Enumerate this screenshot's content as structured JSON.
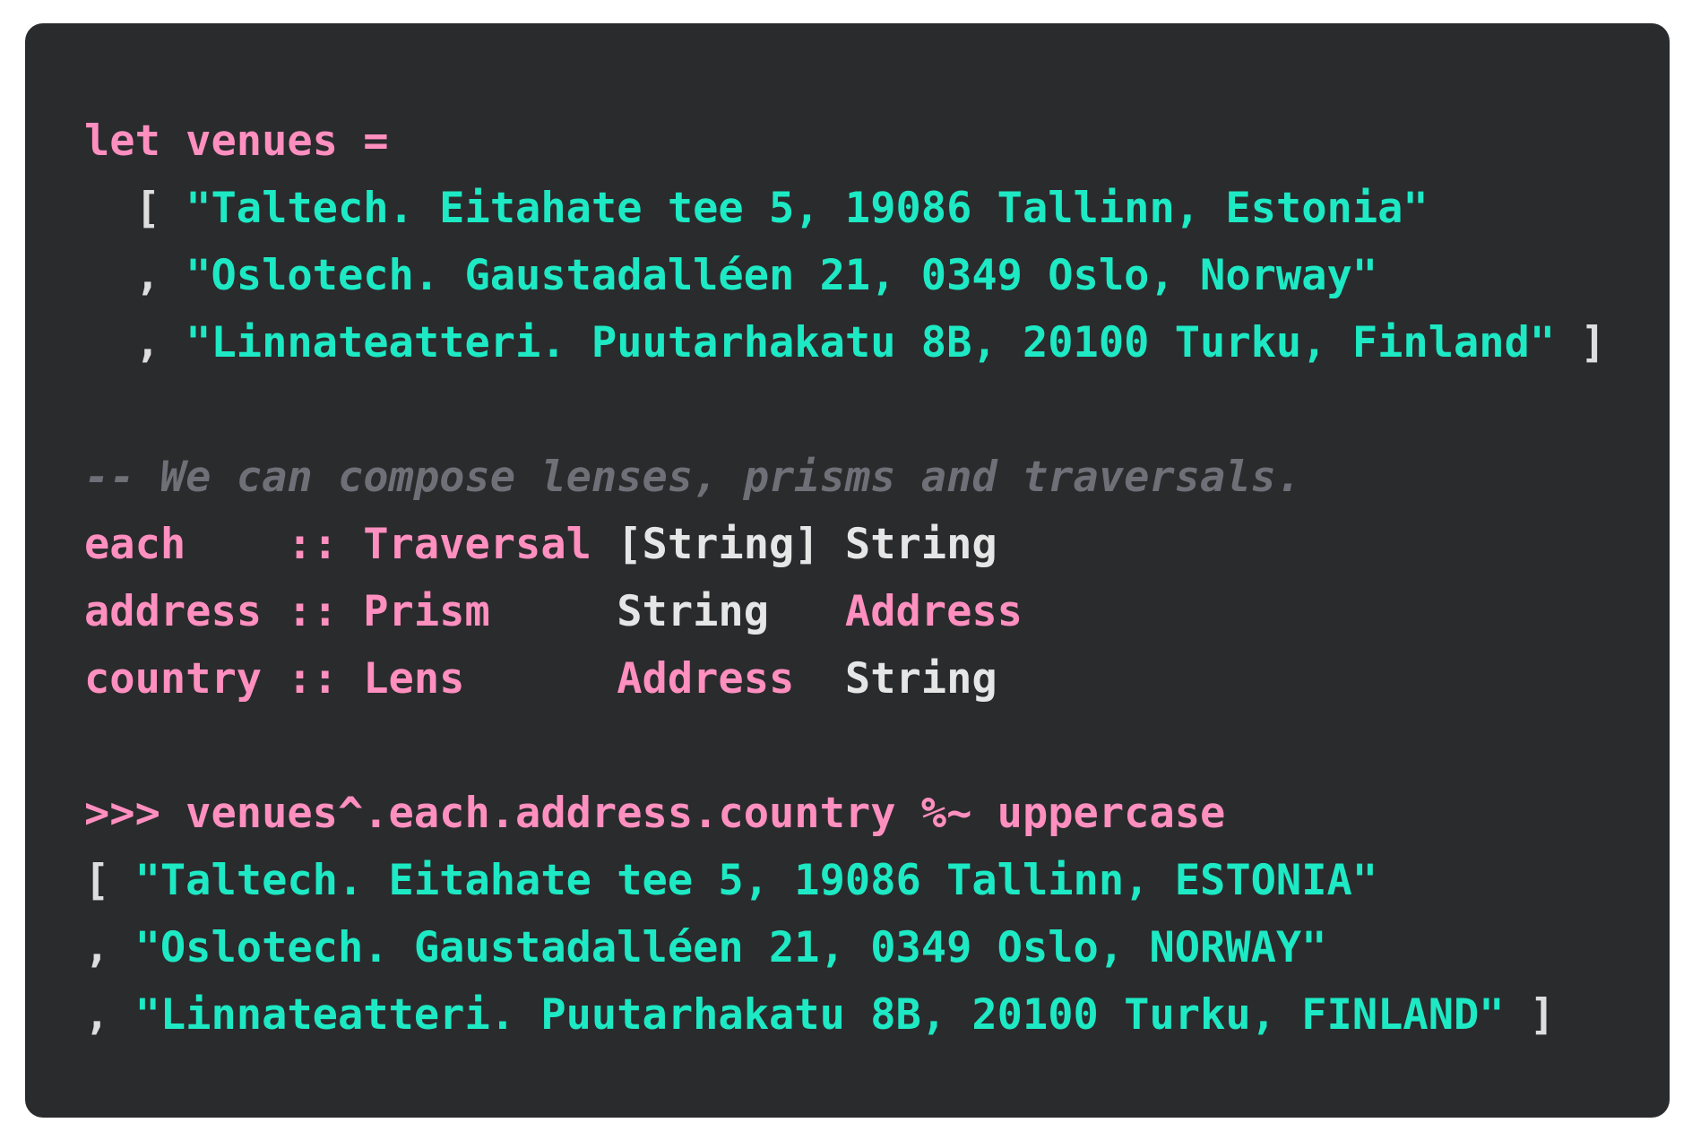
{
  "code": {
    "venues_decl": {
      "keyword_let": "let",
      "name_eq": " venues =",
      "open_bracket": "  [ ",
      "sep": "  , ",
      "close_bracket": " ]",
      "venues": [
        "\"Taltech. Eitahate tee 5, 19086 Tallinn, Estonia\"",
        "\"Oslotech. Gaustadalléen 21, 0349 Oslo, Norway\"",
        "\"Linnateatteri. Puutarhakatu 8B, 20100 Turku, Finland\""
      ]
    },
    "comment": "-- We can compose lenses, prisms and traversals.",
    "signatures": [
      {
        "name": "each    ",
        "sep": ":: ",
        "optic": "Traversal",
        "pad1": " ",
        "source": "[String]",
        "pad2": " ",
        "target": "String"
      },
      {
        "name": "address ",
        "sep": ":: ",
        "optic": "Prism    ",
        "pad1": " ",
        "source": "String  ",
        "pad2": " ",
        "target": "Address"
      },
      {
        "name": "country ",
        "sep": ":: ",
        "optic": "Lens     ",
        "pad1": " ",
        "source": "Address ",
        "pad2": " ",
        "target": "String"
      }
    ],
    "repl": {
      "prompt": ">>>",
      "expression": " venues^.each.address.country %~ uppercase"
    },
    "result": {
      "open_bracket": "[ ",
      "sep": ", ",
      "close_bracket": " ]",
      "venues": [
        "\"Taltech. Eitahate tee 5, 19086 Tallinn, ESTONIA\"",
        "\"Oslotech. Gaustadalléen 21, 0349 Oslo, NORWAY\"",
        "\"Linnateatteri. Puutarhakatu 8B, 20100 Turku, FINLAND\""
      ]
    }
  },
  "colors": {
    "background": "#2a2b2d",
    "keyword": "#ff8fbf",
    "string": "#1de9c4",
    "comment": "#6f7077",
    "text": "#e6e6e6"
  }
}
